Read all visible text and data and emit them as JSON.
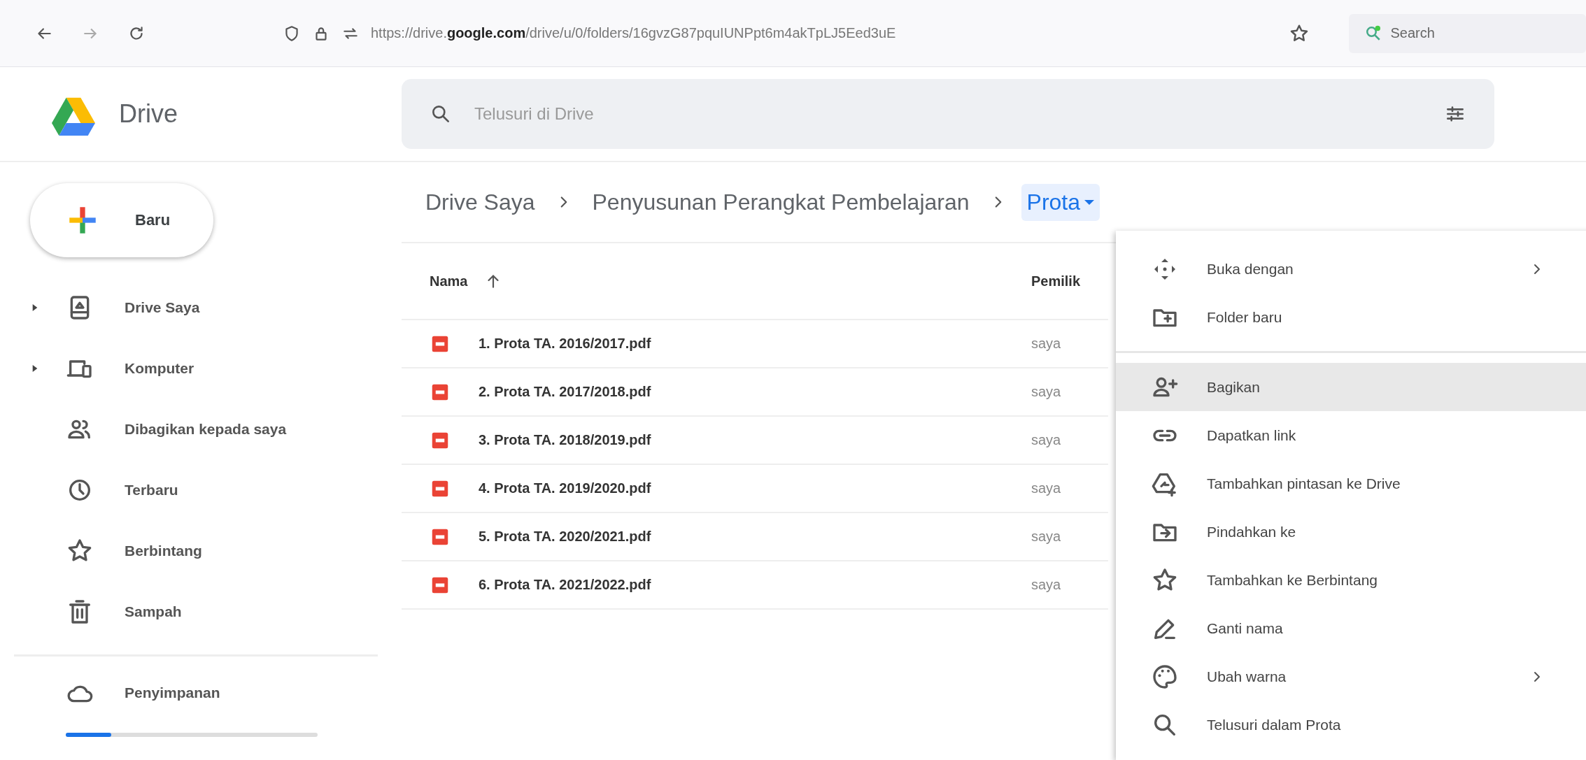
{
  "browser": {
    "url": "https://drive.**google.com**/drive/u/0/folders/16gvzG87pquIUNPpt6m4akTpLJ5Eed3uE",
    "search_label": "Search"
  },
  "app": {
    "name": "Drive"
  },
  "search": {
    "placeholder": "Telusuri di Drive"
  },
  "new_button": {
    "label": "Baru"
  },
  "sidebar": {
    "items": [
      {
        "label": "Drive Saya",
        "expandable": true
      },
      {
        "label": "Komputer",
        "expandable": true
      },
      {
        "label": "Dibagikan kepada saya",
        "expandable": false
      },
      {
        "label": "Terbaru",
        "expandable": false
      },
      {
        "label": "Berbintang",
        "expandable": false
      },
      {
        "label": "Sampah",
        "expandable": false
      }
    ],
    "storage": {
      "label": "Penyimpanan",
      "level": 0.18
    }
  },
  "breadcrumb": [
    {
      "label": "Drive Saya",
      "selected": false
    },
    {
      "label": "Penyusunan Perangkat Pembelajaran",
      "selected": false
    },
    {
      "label": "Prota",
      "selected": true
    }
  ],
  "table": {
    "columns": [
      "Nama",
      "Pemilik"
    ],
    "rows": [
      {
        "name": "1. Prota TA. 2016/2017.pdf",
        "owner": "saya"
      },
      {
        "name": "2. Prota TA. 2017/2018.pdf",
        "owner": "saya"
      },
      {
        "name": "3. Prota TA. 2018/2019.pdf",
        "owner": "saya"
      },
      {
        "name": "4. Prota TA. 2019/2020.pdf",
        "owner": "saya"
      },
      {
        "name": "5. Prota TA. 2020/2021.pdf",
        "owner": "saya"
      },
      {
        "name": "6. Prota TA. 2021/2022.pdf",
        "owner": "saya"
      }
    ]
  },
  "context_menu": {
    "groups": [
      [
        {
          "label": "Buka dengan",
          "submenu": true,
          "selected": false
        },
        {
          "label": "Folder baru",
          "submenu": false,
          "selected": false
        }
      ],
      [
        {
          "label": "Bagikan",
          "submenu": false,
          "selected": true
        },
        {
          "label": "Dapatkan link",
          "submenu": false,
          "selected": false
        },
        {
          "label": "Tambahkan pintasan ke Drive",
          "submenu": false,
          "selected": false
        },
        {
          "label": "Pindahkan ke",
          "submenu": false,
          "selected": false
        },
        {
          "label": "Tambahkan ke Berbintang",
          "submenu": false,
          "selected": false
        },
        {
          "label": "Ganti nama",
          "submenu": false,
          "selected": false
        },
        {
          "label": "Ubah warna",
          "submenu": true,
          "selected": false
        },
        {
          "label": "Telusuri dalam Prota",
          "submenu": false,
          "selected": false
        }
      ]
    ]
  }
}
